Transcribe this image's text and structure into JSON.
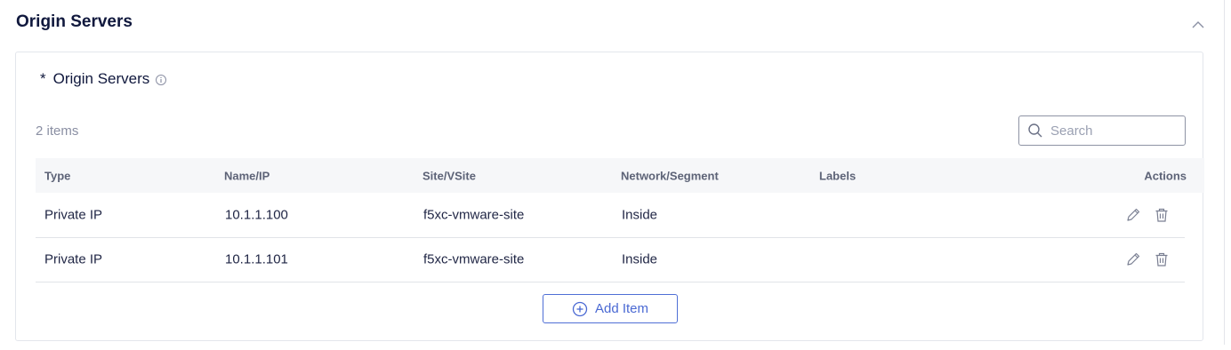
{
  "section": {
    "title": "Origin Servers",
    "collapse_icon": "chevron-up-icon"
  },
  "field": {
    "required_mark": "*",
    "label": "Origin Servers",
    "info_icon": "info-icon"
  },
  "table": {
    "count_text": "2 items",
    "search": {
      "placeholder": "Search",
      "value": ""
    },
    "columns": [
      "Type",
      "Name/IP",
      "Site/VSite",
      "Network/Segment",
      "Labels",
      "Actions"
    ],
    "rows": [
      {
        "type": "Private IP",
        "name_ip": "10.1.1.100",
        "site": "f5xc-vmware-site",
        "network": "Inside",
        "labels": ""
      },
      {
        "type": "Private IP",
        "name_ip": "10.1.1.101",
        "site": "f5xc-vmware-site",
        "network": "Inside",
        "labels": ""
      }
    ],
    "row_actions": [
      "edit-icon",
      "trash-icon"
    ],
    "add_item_label": "Add Item"
  },
  "colors": {
    "accent": "#4a69d3",
    "title": "#10183d",
    "header_bg": "#f6f7f9",
    "border": "#e3e6ec"
  }
}
